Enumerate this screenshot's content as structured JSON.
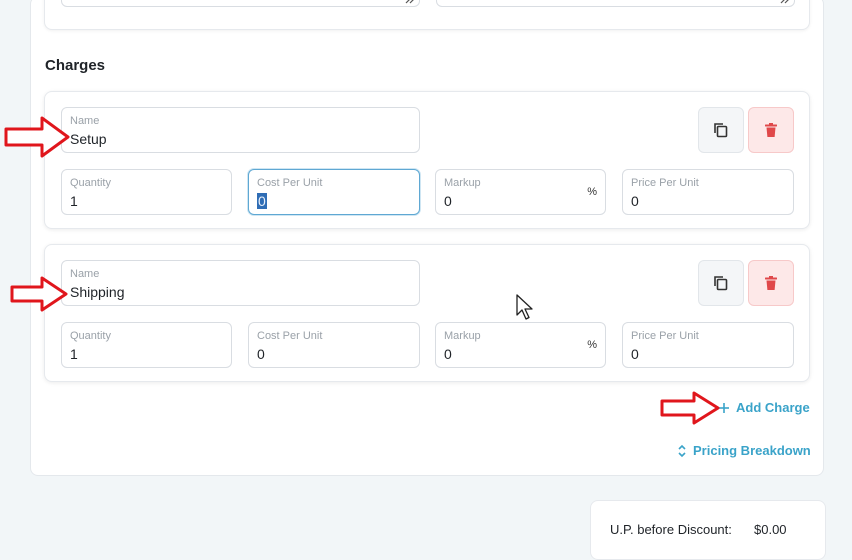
{
  "section": {
    "title": "Charges"
  },
  "charges": [
    {
      "name_label": "Name",
      "name_value": "Setup",
      "quantity_label": "Quantity",
      "quantity_value": "1",
      "cost_label": "Cost Per Unit",
      "cost_value": "0",
      "markup_label": "Markup",
      "markup_value": "0",
      "markup_suffix": "%",
      "price_label": "Price Per Unit",
      "price_value": "0"
    },
    {
      "name_label": "Name",
      "name_value": "Shipping",
      "quantity_label": "Quantity",
      "quantity_value": "1",
      "cost_label": "Cost Per Unit",
      "cost_value": "0",
      "markup_label": "Markup",
      "markup_value": "0",
      "markup_suffix": "%",
      "price_label": "Price Per Unit",
      "price_value": "0"
    }
  ],
  "actions": {
    "add_charge": "Add Charge",
    "pricing_breakdown": "Pricing Breakdown"
  },
  "summary": {
    "up_before_discount_label": "U.P. before Discount:",
    "up_before_discount_value": "$0.00"
  },
  "colors": {
    "accent": "#3aa3c9",
    "delete_bg": "#fde8e8",
    "delete_icon": "#e0484a",
    "annotation_arrow": "#e0161c"
  }
}
